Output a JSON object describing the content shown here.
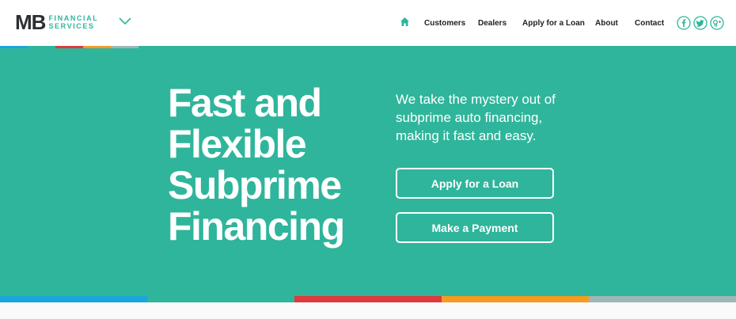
{
  "logo": {
    "mark": "MB",
    "line1": "FINANCIAL",
    "line2": "SERVICES"
  },
  "nav": {
    "items": [
      "Customers",
      "Dealers",
      "Apply for a Loan",
      "About",
      "Contact"
    ]
  },
  "social": {
    "icons": [
      "facebook-icon",
      "twitter-icon",
      "google-plus-icon"
    ]
  },
  "hero": {
    "headline": [
      "Fast and",
      "Flexible",
      "Subprime",
      "Financing"
    ],
    "tagline": "We take the mystery out of subprime auto financing, making it fast and easy.",
    "apply_label": "Apply for a Loan",
    "payment_label": "Make a Payment"
  },
  "colors": {
    "brand_teal": "#2fb59b",
    "stripe_blue": "#1aa6dc",
    "stripe_red": "#e0393e",
    "stripe_orange": "#f59a23",
    "stripe_gray": "#9fb6b7"
  }
}
